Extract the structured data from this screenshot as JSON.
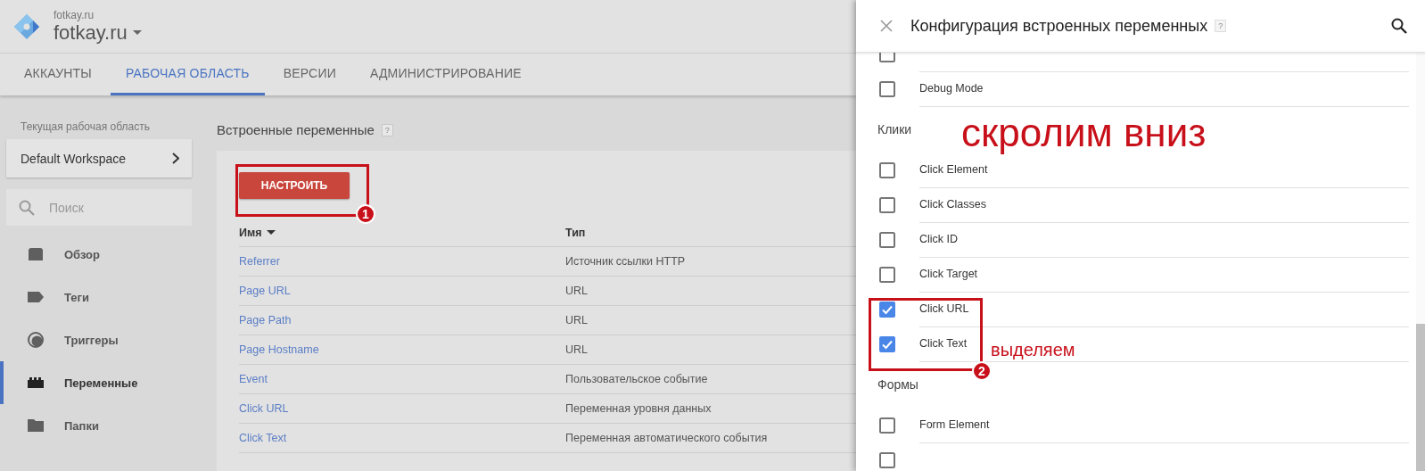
{
  "header": {
    "account": "fotkay.ru",
    "container": "fotkay.ru"
  },
  "tabs": [
    {
      "label": "АККАУНТЫ",
      "selected": false
    },
    {
      "label": "РАБОЧАЯ ОБЛАСТЬ",
      "selected": true
    },
    {
      "label": "ВЕРСИИ",
      "selected": false
    },
    {
      "label": "АДМИНИСТРИРОВАНИЕ",
      "selected": false
    }
  ],
  "sidebar": {
    "workspace_label": "Текущая рабочая область",
    "workspace": "Default Workspace",
    "search": {
      "placeholder": "Поиск"
    },
    "items": [
      {
        "label": "Обзор",
        "kind": "overview",
        "selected": false
      },
      {
        "label": "Теги",
        "kind": "tags",
        "selected": false
      },
      {
        "label": "Триггеры",
        "kind": "triggers",
        "selected": false
      },
      {
        "label": "Переменные",
        "kind": "variables",
        "selected": true
      },
      {
        "label": "Папки",
        "kind": "folders",
        "selected": false
      }
    ]
  },
  "main": {
    "title": "Встроенные переменные",
    "help": "?",
    "button": "НАСТРОИТЬ",
    "table": {
      "columns": [
        "Имя",
        "Тип"
      ],
      "rows": [
        [
          "Referrer",
          "Источник ссылки HTTP"
        ],
        [
          "Page URL",
          "URL"
        ],
        [
          "Page Path",
          "URL"
        ],
        [
          "Page Hostname",
          "URL"
        ],
        [
          "Event",
          "Пользовательское событие"
        ],
        [
          "Click URL",
          "Переменная уровня данных"
        ],
        [
          "Click Text",
          "Переменная автоматического события"
        ]
      ]
    }
  },
  "panel": {
    "title": "Конфигурация встроенных переменных",
    "help": "?",
    "items": [
      {
        "kind": "check",
        "checked": false
      },
      {
        "kind": "check",
        "label": "Debug Mode",
        "checked": false
      },
      {
        "kind": "section",
        "label": "Клики"
      },
      {
        "kind": "check",
        "label": "Click Element",
        "checked": false
      },
      {
        "kind": "check",
        "label": "Click Classes",
        "checked": false
      },
      {
        "kind": "check",
        "label": "Click ID",
        "checked": false
      },
      {
        "kind": "check",
        "label": "Click Target",
        "checked": false
      },
      {
        "kind": "check",
        "label": "Click URL",
        "checked": true
      },
      {
        "kind": "check",
        "label": "Click Text",
        "checked": true
      },
      {
        "kind": "section",
        "label": "Формы"
      },
      {
        "kind": "check",
        "label": "Form Element",
        "checked": false
      },
      {
        "kind": "check",
        "checked": false
      }
    ]
  },
  "annotations": {
    "scroll_note": "скролим вниз",
    "select_note": "выделяем",
    "badges": [
      "1",
      "2"
    ]
  }
}
